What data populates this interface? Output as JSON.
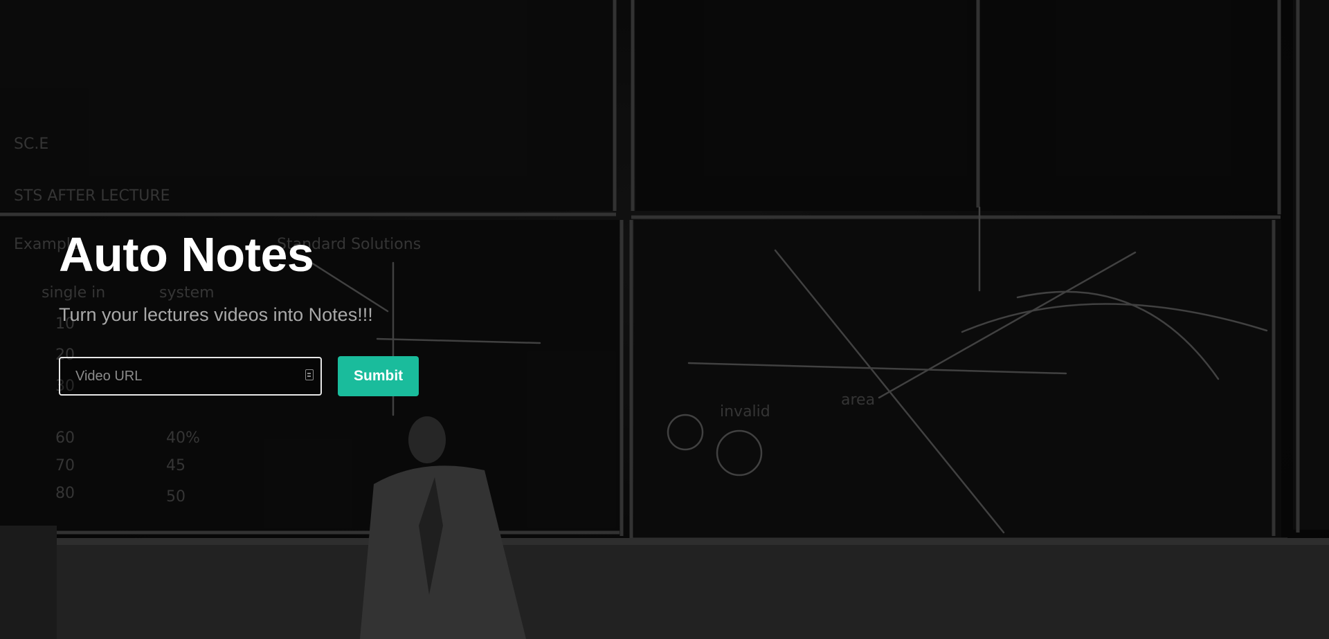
{
  "app": {
    "title": "Auto Notes",
    "subtitle": "Turn your lectures videos into Notes!!!"
  },
  "form": {
    "url_placeholder": "Video URL",
    "url_value": "",
    "submit_label": "Sumbit"
  },
  "colors": {
    "accent": "#1abc9c",
    "title": "#ffffff",
    "subtitle": "#a9a9a9",
    "background": "#0b0b0b"
  },
  "icons": {
    "field_icon": "autofill-card-icon"
  }
}
